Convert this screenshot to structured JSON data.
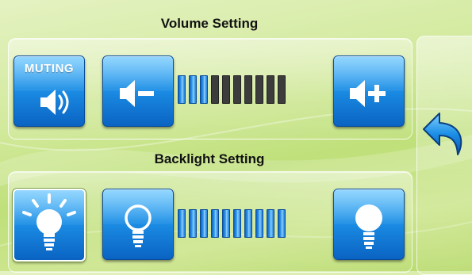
{
  "volume": {
    "title": "Volume Setting",
    "mute_button_label": "MUTING",
    "mute_icon": "speaker-icon",
    "decrease_icon": "volume-down-icon",
    "increase_icon": "volume-up-icon",
    "level": 3,
    "level_max": 10
  },
  "backlight": {
    "title": "Backlight Setting",
    "auto_icon": "bright-bulb-icon",
    "decrease_icon": "bulb-outline-icon",
    "increase_icon": "bulb-filled-icon",
    "level": 10,
    "level_max": 10
  },
  "navigation": {
    "back_icon": "back-arrow-icon"
  },
  "colors": {
    "button_blue": "#1c8fe6",
    "level_off": "#3c3c3c"
  }
}
